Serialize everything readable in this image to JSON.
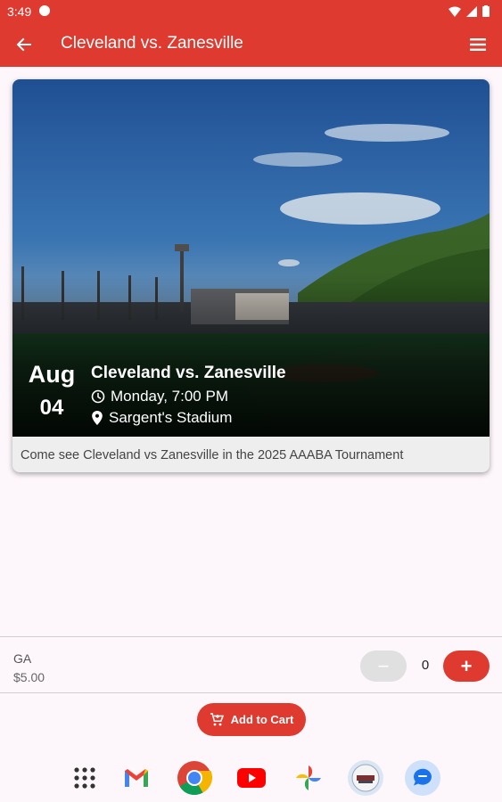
{
  "status_bar": {
    "time": "3:49"
  },
  "app_bar": {
    "title": "Cleveland vs. Zanesville"
  },
  "event": {
    "month": "Aug",
    "day": "04",
    "title": "Cleveland vs. Zanesville",
    "time": "Monday, 7:00 PM",
    "venue": "Sargent's Stadium",
    "description": "Come see Cleveland vs Zanesville in the 2025 AAABA Tournament"
  },
  "ticket": {
    "name": "GA",
    "price": "$5.00",
    "quantity": "0",
    "minus_label": "−",
    "plus_label": "+"
  },
  "cart": {
    "label": "Add to Cart"
  },
  "colors": {
    "primary": "#df3a30",
    "background": "#fdf7fb",
    "card": "#eeeeee"
  },
  "dock": {
    "apps": [
      "app-drawer",
      "gmail",
      "chrome",
      "youtube",
      "photos",
      "team-app",
      "messages"
    ]
  }
}
